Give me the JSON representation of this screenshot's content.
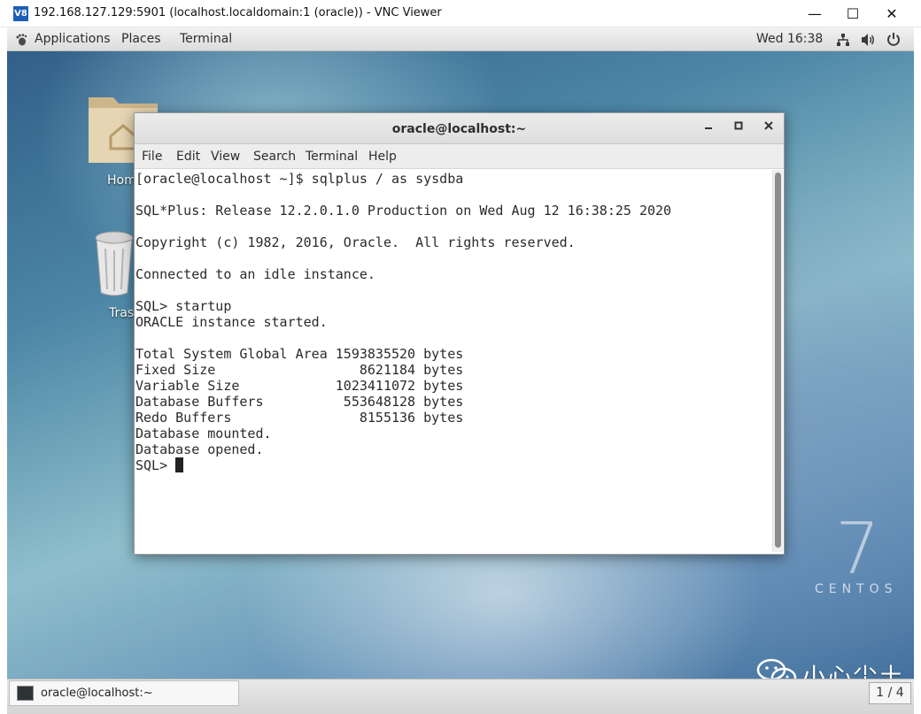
{
  "vnc": {
    "logo": "V8",
    "title": "192.168.127.129:5901 (localhost.localdomain:1 (oracle)) - VNC Viewer",
    "minimize": "—",
    "maximize": "☐",
    "close": "✕"
  },
  "topbar": {
    "applications": "Applications",
    "places": "Places",
    "terminal": "Terminal",
    "clock": "Wed 16:38"
  },
  "desktop": {
    "home_label": "Hom",
    "trash_label": "Tras"
  },
  "centos": {
    "seven": "7",
    "word": "CENTOS"
  },
  "terminal_window": {
    "title": "oracle@localhost:~",
    "menu": [
      "File",
      "Edit",
      "View",
      "Search",
      "Terminal",
      "Help"
    ],
    "lines": [
      "[oracle@localhost ~]$ sqlplus / as sysdba",
      "",
      "SQL*Plus: Release 12.2.0.1.0 Production on Wed Aug 12 16:38:25 2020",
      "",
      "Copyright (c) 1982, 2016, Oracle.  All rights reserved.",
      "",
      "Connected to an idle instance.",
      "",
      "SQL> startup",
      "ORACLE instance started.",
      "",
      "Total System Global Area 1593835520 bytes",
      "Fixed Size                  8621184 bytes",
      "Variable Size            1023411072 bytes",
      "Database Buffers          553648128 bytes",
      "Redo Buffers                8155136 bytes",
      "Database mounted.",
      "Database opened."
    ],
    "prompt": "SQL> "
  },
  "taskbar": {
    "item_label": "oracle@localhost:~",
    "workspace": "1 / 4"
  },
  "watermark": {
    "text": "小心尘土"
  },
  "icons": {
    "applications": "gnome-foot-icon",
    "network": "network-icon",
    "volume": "speaker-icon",
    "power": "power-icon"
  }
}
